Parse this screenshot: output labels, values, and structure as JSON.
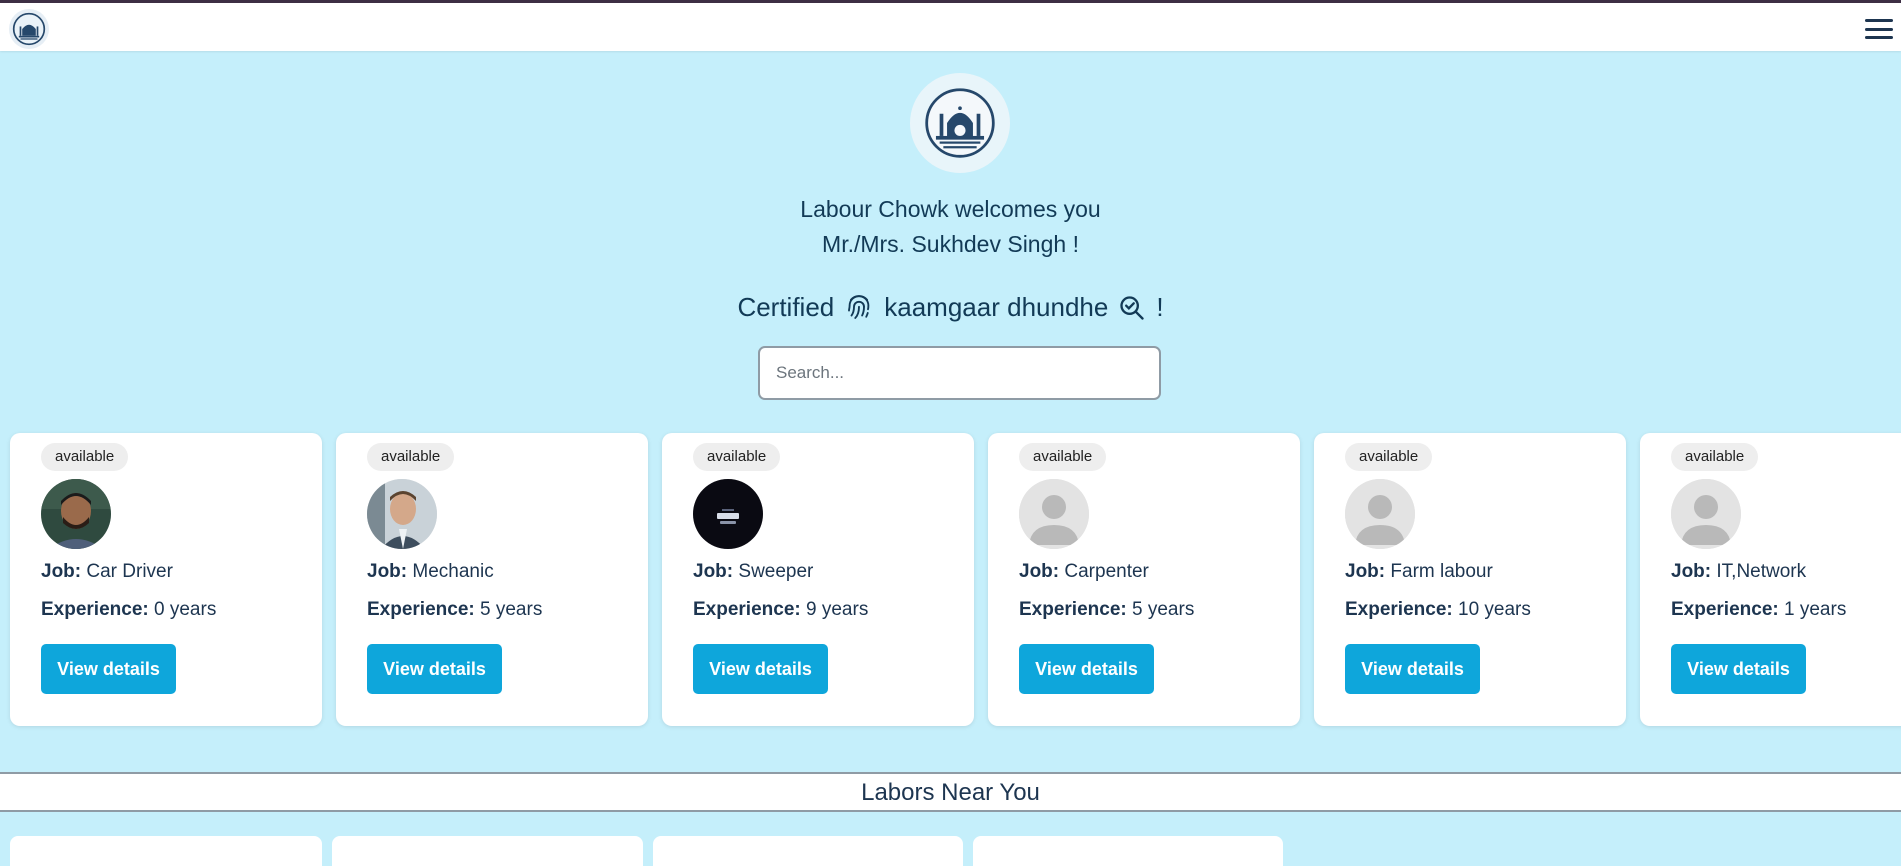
{
  "header": {
    "logo_icon": "monument-logo-icon",
    "menu_icon": "hamburger-menu-icon"
  },
  "hero": {
    "logo_icon": "monument-logo-icon",
    "welcome_line1": "Labour Chowk welcomes you",
    "welcome_line2": "Mr./Mrs. Sukhdev Singh !",
    "tagline_part1": "Certified",
    "tagline_icon1": "fingerprint-icon",
    "tagline_part2": "kaamgaar dhundhe",
    "tagline_icon2": "search-check-icon",
    "tagline_end": "!"
  },
  "search": {
    "placeholder": "Search..."
  },
  "labels": {
    "job": "Job:",
    "experience": "Experience:"
  },
  "cards": [
    {
      "status": "available",
      "job": "Car Driver",
      "experience": "0 years",
      "button": "View details",
      "avatar": "photo-man-beard"
    },
    {
      "status": "available",
      "job": "Mechanic",
      "experience": "5 years",
      "button": "View details",
      "avatar": "photo-man-suit"
    },
    {
      "status": "available",
      "job": "Sweeper",
      "experience": "9 years",
      "button": "View details",
      "avatar": "photo-dark"
    },
    {
      "status": "available",
      "job": "Carpenter",
      "experience": "5 years",
      "button": "View details",
      "avatar": "default-user-icon"
    },
    {
      "status": "available",
      "job": "Farm labour",
      "experience": "10 years",
      "button": "View details",
      "avatar": "default-user-icon"
    },
    {
      "status": "available",
      "job": "IT,Network",
      "experience": "1 years",
      "button": "View details",
      "avatar": "default-user-icon"
    }
  ],
  "near": {
    "title": "Labors Near You"
  },
  "colors": {
    "background": "#c5effb",
    "button": "#0ea6db",
    "text": "#1d3550"
  }
}
